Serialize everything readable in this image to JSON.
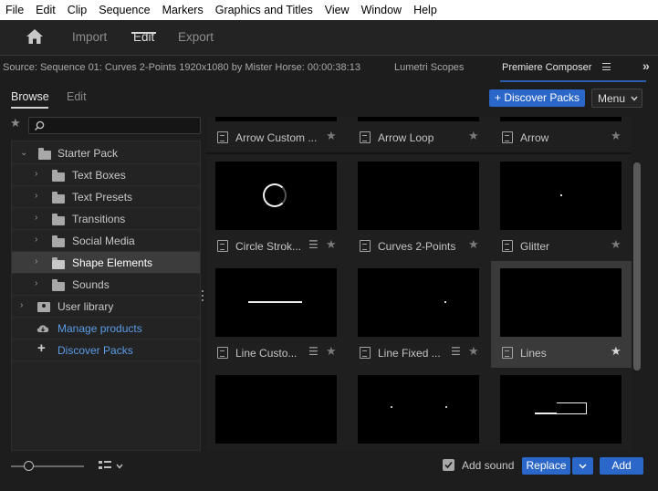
{
  "menu": [
    "File",
    "Edit",
    "Clip",
    "Sequence",
    "Markers",
    "Graphics and Titles",
    "View",
    "Window",
    "Help"
  ],
  "workspace": {
    "import_label": "Import",
    "edit_label": "Edit",
    "export_label": "Export"
  },
  "panel": {
    "source_label": "Source: Sequence 01: Curves 2-Points 1920x1080 by Mister Horse: 00:00:38:13",
    "lumetri_label": "Lumetri Scopes",
    "composer_label": "Premiere Composer",
    "more_label": "»"
  },
  "tabs": {
    "browse": "Browse",
    "edit": "Edit"
  },
  "toolbar": {
    "discover_label": "+ Discover Packs",
    "menu_label": "Menu"
  },
  "tree": [
    {
      "label": "Starter Pack"
    },
    {
      "label": "Text Boxes"
    },
    {
      "label": "Text Presets"
    },
    {
      "label": "Transitions"
    },
    {
      "label": "Social Media"
    },
    {
      "label": "Shape Elements"
    },
    {
      "label": "Sounds"
    },
    {
      "label": "User library"
    },
    {
      "label": "Manage products"
    },
    {
      "label": "Discover Packs"
    }
  ],
  "grid": [
    {
      "label": "Arrow Custom ..."
    },
    {
      "label": "Arrow Loop"
    },
    {
      "label": "Arrow"
    },
    {
      "label": "Circle Strok..."
    },
    {
      "label": "Curves 2-Points"
    },
    {
      "label": "Glitter"
    },
    {
      "label": "Line Custo..."
    },
    {
      "label": "Line Fixed ..."
    },
    {
      "label": "Lines"
    }
  ],
  "bottom": {
    "add_sound_label": "Add sound",
    "replace_label": "Replace",
    "add_label": "Add"
  },
  "colors": {
    "accent": "#2b66c9",
    "menubar": "#ffffff",
    "panel_bg": "#1d1d1d"
  }
}
